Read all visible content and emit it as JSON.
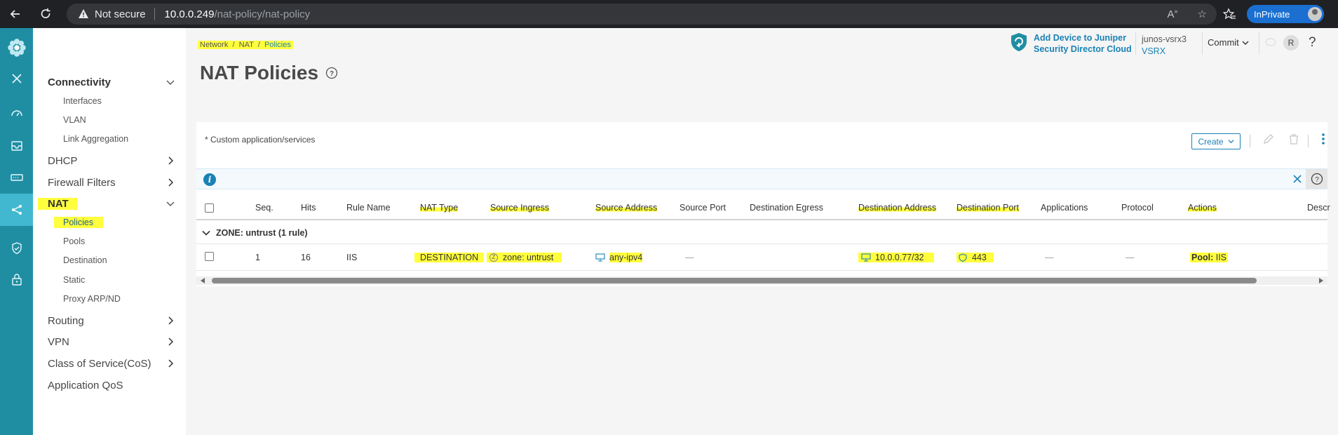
{
  "browser": {
    "not_secure": "Not secure",
    "url_host": "10.0.0.249",
    "url_path": "/nat-policy/nat-policy",
    "inprivate": "InPrivate"
  },
  "nav": {
    "connectivity": "Connectivity",
    "interfaces": "Interfaces",
    "vlan": "VLAN",
    "link_aggregation": "Link Aggregation",
    "dhcp": "DHCP",
    "firewall_filters": "Firewall Filters",
    "nat": "NAT",
    "policies": "Policies",
    "pools": "Pools",
    "destination": "Destination",
    "static": "Static",
    "proxy_arp": "Proxy ARP/ND",
    "routing": "Routing",
    "vpn": "VPN",
    "cos": "Class of Service(CoS)",
    "app_qos": "Application QoS"
  },
  "breadcrumb": {
    "network": "Network",
    "sep": "/",
    "nat": "NAT",
    "policies": "Policies"
  },
  "page_title": "NAT Policies",
  "header": {
    "sd_line1": "Add Device to Juniper",
    "sd_line2": "Security Director Cloud",
    "device_name": "junos-vsrx3",
    "device_type": "VSRX",
    "commit": "Commit",
    "user_initial": "R",
    "help": "?"
  },
  "card": {
    "note": "* Custom application/services",
    "create": "Create"
  },
  "table": {
    "columns": {
      "seq": "Seq.",
      "hits": "Hits",
      "rule_name": "Rule Name",
      "nat_type": "NAT Type",
      "source_ingress": "Source Ingress",
      "source_address": "Source Address",
      "source_port": "Source Port",
      "destination_egress": "Destination Egress",
      "destination_address": "Destination Address",
      "destination_port": "Destination Port",
      "applications": "Applications",
      "protocol": "Protocol",
      "actions": "Actions",
      "description": "Descr"
    },
    "zone_group": "ZONE: untrust (1 rule)",
    "row": {
      "seq": "1",
      "hits": "16",
      "rule_name": "IIS",
      "nat_type": "DESTINATION",
      "source_ingress_icon": "Z",
      "source_ingress": "zone: untrust",
      "source_address": "any-ipv4",
      "source_port": "—",
      "destination_address": "10.0.0.77/32",
      "destination_port": "443",
      "applications": "—",
      "protocol": "—",
      "actions_label": "Pool:",
      "actions_value": "IIS"
    }
  },
  "colors": {
    "rail": "#1f8ea3",
    "rail_active": "#41b8cf",
    "accent": "#1a82b5",
    "highlight": "#ffff3d"
  }
}
